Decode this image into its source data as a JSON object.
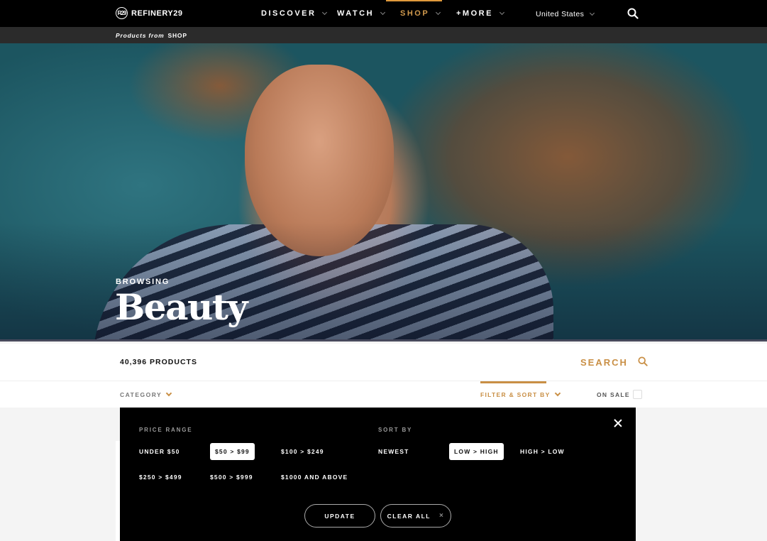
{
  "nav": {
    "logo_mark": "R29",
    "logo_text": "REFINERY29",
    "items": [
      {
        "label": "DISCOVER",
        "active": false
      },
      {
        "label": "WATCH",
        "active": false
      },
      {
        "label": "SHOP",
        "active": true
      },
      {
        "label": "+MORE",
        "active": false
      }
    ],
    "country": "United States",
    "search_icon": "search-icon"
  },
  "subbar": {
    "prefix": "Products from",
    "source": "SHOP"
  },
  "hero": {
    "eyebrow": "BROWSING",
    "title": "Beauty"
  },
  "products": {
    "count_label": "40,396 PRODUCTS",
    "search_label": "SEARCH"
  },
  "filters": {
    "category_label": "CATEGORY",
    "filter_sort_label": "FILTER & SORT BY",
    "on_sale_label": "ON SALE",
    "on_sale_checked": false
  },
  "panel": {
    "price_range_label": "PRICE RANGE",
    "price_options": [
      {
        "label": "UNDER $50",
        "selected": false
      },
      {
        "label": "$50 > $99",
        "selected": true
      },
      {
        "label": "$100 > $249",
        "selected": false
      },
      {
        "label": "$250 > $499",
        "selected": false
      },
      {
        "label": "$500 > $999",
        "selected": false
      },
      {
        "label": "$1000 AND ABOVE",
        "selected": false
      }
    ],
    "sort_by_label": "SORT BY",
    "sort_options": [
      {
        "label": "NEWEST",
        "selected": false
      },
      {
        "label": "LOW > HIGH",
        "selected": true
      },
      {
        "label": "HIGH > LOW",
        "selected": false
      }
    ],
    "update_label": "UPDATE",
    "clear_all_label": "CLEAR ALL",
    "clear_icon": "×"
  },
  "colors": {
    "accent": "#c98f45",
    "nav_active": "#d19a4d",
    "nav_bg": "#000000",
    "subbar_bg": "#2b2b2b"
  }
}
